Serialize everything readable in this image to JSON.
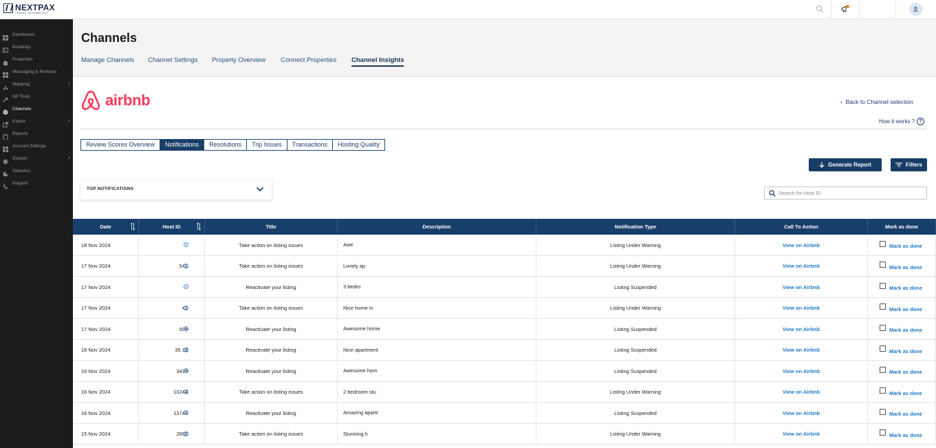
{
  "brand": {
    "name": "NEXTPAX",
    "tagline": "TRAVEL TECHNOLOGY"
  },
  "sidebar": {
    "items": [
      {
        "label": "Dashboard",
        "icon": "grid-icon",
        "active": false,
        "expandable": false
      },
      {
        "label": "Bookings",
        "icon": "book-icon",
        "active": false,
        "expandable": false
      },
      {
        "label": "Properties",
        "icon": "building-icon",
        "active": false,
        "expandable": false
      },
      {
        "label": "Messaging & Reviews",
        "icon": "grid-icon",
        "active": false,
        "expandable": false
      },
      {
        "label": "Mapping",
        "icon": "mapping-icon",
        "active": false,
        "expandable": true
      },
      {
        "label": "NP Tools",
        "icon": "wrench-icon",
        "active": false,
        "expandable": false
      },
      {
        "label": "Channels",
        "icon": "globe-icon",
        "active": true,
        "expandable": false
      },
      {
        "label": "Export",
        "icon": "export-icon",
        "active": false,
        "expandable": true
      },
      {
        "label": "Reports",
        "icon": "clipboard-icon",
        "active": false,
        "expandable": false
      },
      {
        "label": "Account Settings",
        "icon": "grid-icon",
        "active": false,
        "expandable": false
      },
      {
        "label": "System",
        "icon": "gear-icon",
        "active": false,
        "expandable": true
      },
      {
        "label": "Statistics",
        "icon": "chart-icon",
        "active": false,
        "expandable": false
      },
      {
        "label": "Support",
        "icon": "phone-icon",
        "active": false,
        "expandable": false
      }
    ]
  },
  "header": {
    "title": "Channels",
    "tabs": [
      {
        "label": "Manage Channels",
        "active": false
      },
      {
        "label": "Channel Settings",
        "active": false
      },
      {
        "label": "Property Overview",
        "active": false
      },
      {
        "label": "Connect Properties",
        "active": false
      },
      {
        "label": "Channel Insights",
        "active": true
      }
    ]
  },
  "channel": {
    "name": "airbnb",
    "back_label": "Back to Channel selection",
    "how_label": "How it works ?"
  },
  "subtabs": [
    {
      "label": "Review Scores Overview",
      "active": false
    },
    {
      "label": "Notifications",
      "active": true
    },
    {
      "label": "Resolutions",
      "active": false
    },
    {
      "label": "Trip Issues",
      "active": false
    },
    {
      "label": "Transactions",
      "active": false
    },
    {
      "label": "Hosting Quality",
      "active": false
    }
  ],
  "actions": {
    "generate_report": "Generate Report",
    "filters": "Filters"
  },
  "top_notifications": {
    "label": "TOP NOTIFICATIONS"
  },
  "search": {
    "placeholder": "Search for Host ID",
    "value": ""
  },
  "table": {
    "columns": [
      "Date",
      "Host ID",
      "Title",
      "Description",
      "Notification Type",
      "Call To Action",
      "Mark as done"
    ],
    "rows": [
      {
        "date": "18 Nov 2024",
        "host_id": "",
        "title": "Take action on listing issues",
        "description": "Awe ",
        "type": "Listing Under Warning",
        "cta": "View on Airbnb",
        "mark": "Mark as done"
      },
      {
        "date": "17 Nov 2024",
        "host_id": "541",
        "title": "Take action on listing issues",
        "description": "Lovely ap",
        "type": "Listing Under Warning",
        "cta": "View on Airbnb",
        "mark": "Mark as done"
      },
      {
        "date": "17 Nov 2024",
        "host_id": "",
        "title": "Reactivate your listing",
        "description": "3 bedro",
        "type": "Listing Suspended",
        "cta": "View on Airbnb",
        "mark": "Mark as done"
      },
      {
        "date": "17 Nov 2024",
        "host_id": "41",
        "title": "Take action on listing issues",
        "description": "Nice home in",
        "type": "Listing Under Warning",
        "cta": "View on Airbnb",
        "mark": "Mark as done"
      },
      {
        "date": "17 Nov 2024",
        "host_id": "509",
        "title": "Reactivate your listing",
        "description": "Awesome home",
        "type": "Listing Suspended",
        "cta": "View on Airbnb",
        "mark": "Mark as done"
      },
      {
        "date": "16 Nov 2024",
        "host_id": "35  33",
        "title": "Reactivate your listing",
        "description": "Nice apartment",
        "type": "Listing Suspended",
        "cta": "View on Airbnb",
        "mark": "Mark as done"
      },
      {
        "date": "16 Nov 2024",
        "host_id": "3439",
        "title": "Reactivate your listing",
        "description": "Awesome hom",
        "type": "Listing Suspended",
        "cta": "View on Airbnb",
        "mark": "Mark as done"
      },
      {
        "date": "16 Nov 2024",
        "host_id": "10244",
        "title": "Take action on listing issues",
        "description": "2 bedroom stu",
        "type": "Listing Under Warning",
        "cta": "View on Airbnb",
        "mark": "Mark as done"
      },
      {
        "date": "16 Nov 2024",
        "host_id": "13745",
        "title": "Reactivate your listing",
        "description": "Amazing apartr",
        "type": "Listing Suspended",
        "cta": "View on Airbnb",
        "mark": "Mark as done"
      },
      {
        "date": "15 Nov 2024",
        "host_id": "2892",
        "title": "Take action on listing issues",
        "description": "Stunning h",
        "type": "Listing Under Warning",
        "cta": "View on Airbnb",
        "mark": "Mark as done"
      }
    ]
  },
  "colors": {
    "brand_navy": "#183e6b",
    "airbnb_red": "#ff385c",
    "link_blue": "#1f7ac9",
    "sidebar_bg": "#1c1c1c"
  }
}
